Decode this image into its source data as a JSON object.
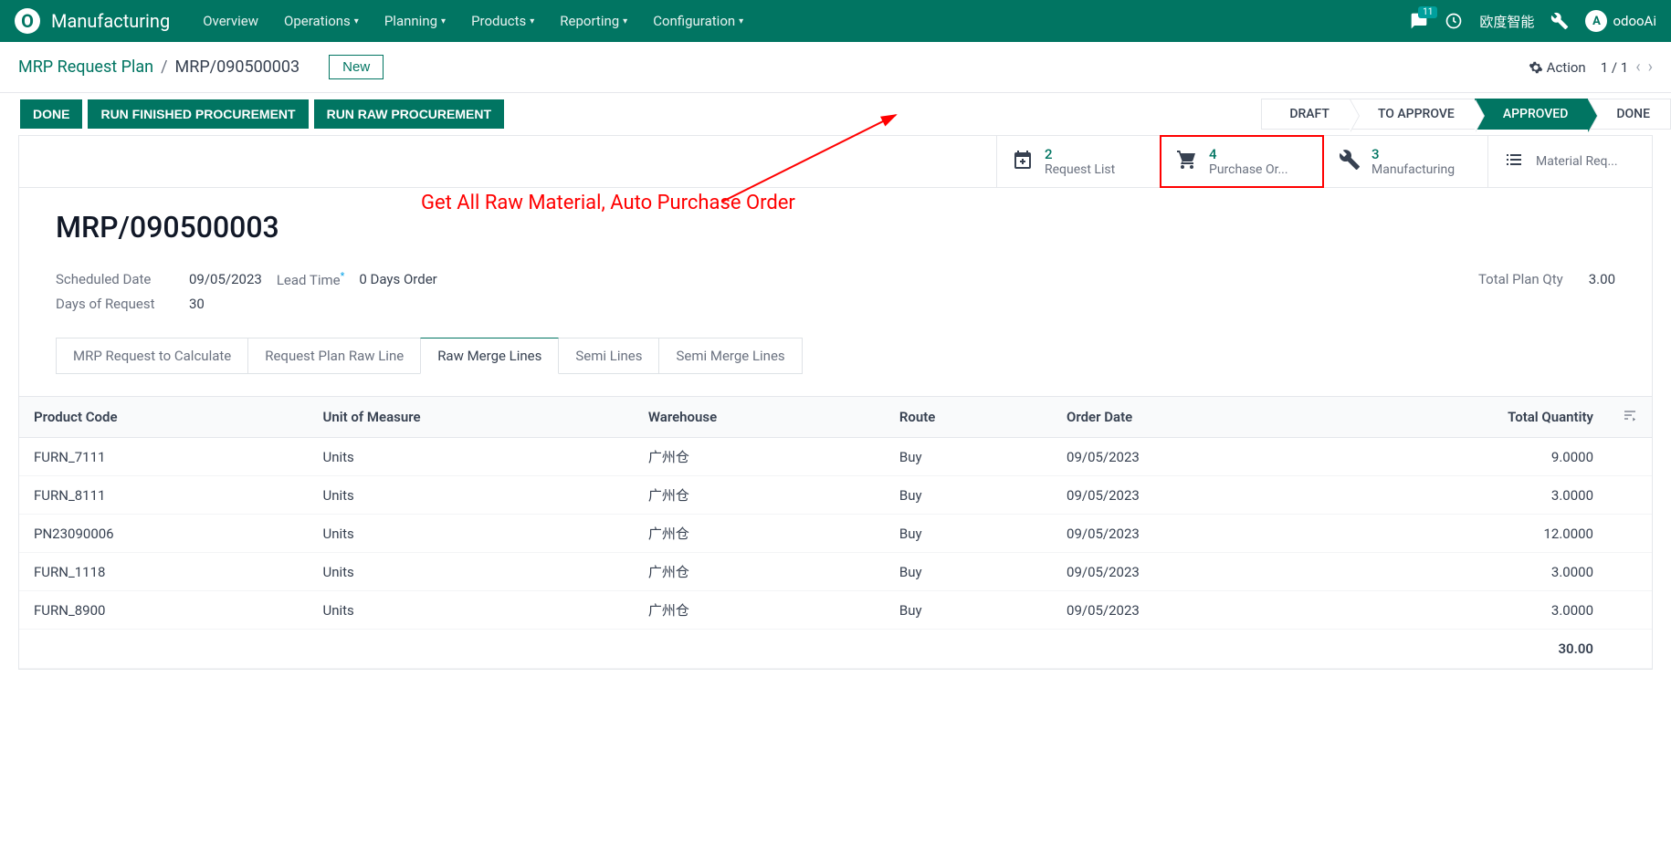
{
  "nav": {
    "brand": "Manufacturing",
    "menu": [
      "Overview",
      "Operations",
      "Planning",
      "Products",
      "Reporting",
      "Configuration"
    ],
    "menu_has_caret": [
      false,
      true,
      true,
      true,
      true,
      true
    ],
    "chat_count": "11",
    "odoo_link": "欧度智能",
    "user_name": "odooAi",
    "user_initial": "A"
  },
  "breadcrumb": {
    "parent": "MRP Request Plan",
    "current": "MRP/090500003",
    "new": "New",
    "action": "Action",
    "page": "1 / 1"
  },
  "statebar": {
    "buttons": [
      "DONE",
      "RUN FINISHED PROCUREMENT",
      "RUN RAW PROCUREMENT"
    ],
    "stages": [
      "DRAFT",
      "TO APPROVE",
      "APPROVED",
      "DONE"
    ],
    "active_index": 2
  },
  "statbuttons": [
    {
      "count": "2",
      "label": "Request List",
      "icon": "calendar-plus"
    },
    {
      "count": "4",
      "label": "Purchase Or...",
      "icon": "cart",
      "highlight": true
    },
    {
      "count": "3",
      "label": "Manufacturing",
      "icon": "wrench"
    },
    {
      "count": "",
      "label": "Material Req...",
      "icon": "list"
    }
  ],
  "record": {
    "title": "MRP/090500003",
    "annotation": "Get All Raw Material, Auto Purchase Order",
    "scheduled_date_label": "Scheduled Date",
    "scheduled_date": "09/05/2023",
    "lead_time_label": "Lead Time",
    "lead_time_suffix": "0 Days Order",
    "total_plan_label": "Total Plan Qty",
    "total_plan_qty": "3.00",
    "days_of_request_label": "Days of Request",
    "days_of_request": "30"
  },
  "tabs": [
    "MRP Request to Calculate",
    "Request Plan Raw Line",
    "Raw Merge Lines",
    "Semi Lines",
    "Semi Merge Lines"
  ],
  "active_tab": 2,
  "table": {
    "columns": [
      "Product Code",
      "Unit of Measure",
      "Warehouse",
      "Route",
      "Order Date",
      "Total Quantity"
    ],
    "rows": [
      {
        "code": "FURN_7111",
        "uom": "Units",
        "wh": "广州仓",
        "route": "Buy",
        "date": "09/05/2023",
        "qty": "9.0000"
      },
      {
        "code": "FURN_8111",
        "uom": "Units",
        "wh": "广州仓",
        "route": "Buy",
        "date": "09/05/2023",
        "qty": "3.0000"
      },
      {
        "code": "PN23090006",
        "uom": "Units",
        "wh": "广州仓",
        "route": "Buy",
        "date": "09/05/2023",
        "qty": "12.0000"
      },
      {
        "code": "FURN_1118",
        "uom": "Units",
        "wh": "广州仓",
        "route": "Buy",
        "date": "09/05/2023",
        "qty": "3.0000"
      },
      {
        "code": "FURN_8900",
        "uom": "Units",
        "wh": "广州仓",
        "route": "Buy",
        "date": "09/05/2023",
        "qty": "3.0000"
      }
    ],
    "footer_qty": "30.00"
  }
}
